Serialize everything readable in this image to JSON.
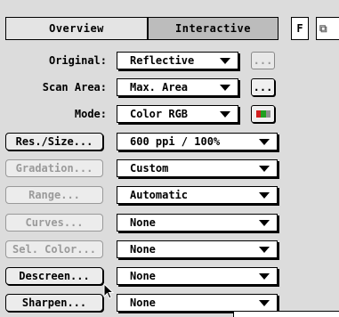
{
  "tabs": {
    "overview": "Overview",
    "interactive": "Interactive"
  },
  "buttons": {
    "f": "F",
    "next": "⧉"
  },
  "rows": {
    "original": {
      "label": "Original:",
      "value": "Reflective",
      "aux": "..."
    },
    "scan_area": {
      "label": "Scan Area:",
      "value": "Max. Area",
      "aux": "..."
    },
    "mode": {
      "label": "Mode:",
      "value": "Color RGB"
    },
    "res_size": {
      "button": "Res./Size...",
      "value": "600 ppi / 100%"
    },
    "gradation": {
      "button": "Gradation...",
      "value": "Custom"
    },
    "range": {
      "button": "Range...",
      "value": "Automatic"
    },
    "curves": {
      "button": "Curves...",
      "value": "None"
    },
    "sel_color": {
      "button": "Sel. Color...",
      "value": "None"
    },
    "descreen": {
      "button": "Descreen...",
      "value": "None"
    },
    "sharpen": {
      "button": "Sharpen...",
      "value": "None"
    }
  }
}
